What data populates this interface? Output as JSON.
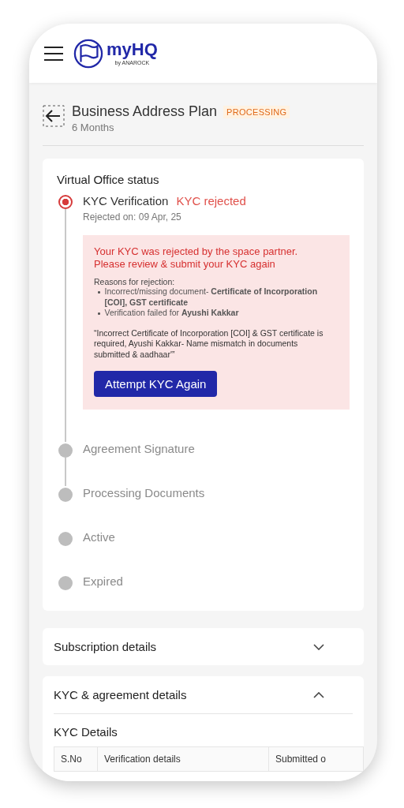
{
  "header": {
    "logo": {
      "name": "myHQ",
      "tagline": "by ANAROCK"
    }
  },
  "plan": {
    "title": "Business Address Plan",
    "badge": "PROCESSING",
    "subtitle": "6 Months"
  },
  "status_card": {
    "title": "Virtual Office status",
    "steps": [
      {
        "label": "KYC Verification",
        "status_text": "KYC rejected",
        "date": "Rejected on: 09 Apr, 25",
        "rejected": true,
        "connected": true
      },
      {
        "label": "Agreement Signature",
        "rejected": false,
        "connected": true
      },
      {
        "label": "Processing Documents",
        "rejected": false,
        "connected": false
      },
      {
        "label": "Active",
        "rejected": false,
        "connected": false
      },
      {
        "label": "Expired",
        "rejected": false,
        "connected": false
      }
    ],
    "rejection": {
      "headline": "Your KYC was rejected by the space partner. Please review & submit your KYC again",
      "reasons_label": "Reasons for rejection:",
      "reasons": [
        "Incorrect/missing document- **Certificate of Incorporation [COI], GST certificate**",
        "Verification failed for **Ayushi Kakkar**"
      ],
      "note": "“Incorrect Certificate of Incorporation [COI] & GST certificate is required, Ayushi Kakkar- Name mismatch in documents submitted & aadhaar'”",
      "button": "Attempt KYC Again"
    }
  },
  "sections": [
    {
      "title": "Subscription details",
      "expanded": false
    },
    {
      "title": "KYC & agreement details",
      "expanded": true
    }
  ],
  "kyc_details": {
    "title": "KYC Details",
    "columns": [
      "S.No",
      "Verification details",
      "Submitted o"
    ]
  }
}
